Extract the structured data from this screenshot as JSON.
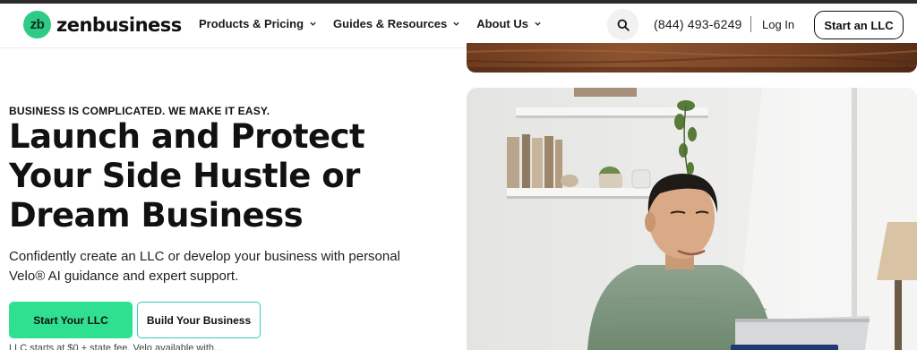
{
  "brand": {
    "logo_mark": "zb",
    "logo_text": "zenbusiness",
    "accent_color": "#2fe090",
    "outline_accent_color": "#2fcfb9"
  },
  "nav": {
    "items": [
      {
        "label": "Products & Pricing",
        "icon": "chevron-down-icon"
      },
      {
        "label": "Guides & Resources",
        "icon": "chevron-down-icon"
      },
      {
        "label": "About Us",
        "icon": "chevron-down-icon"
      }
    ]
  },
  "header_actions": {
    "search_icon": "search-icon",
    "phone": "(844) 493-6249",
    "separator": "|",
    "login_label": "Log In",
    "cta_label": "Start an LLC"
  },
  "hero": {
    "eyebrow": "BUSINESS IS COMPLICATED. WE MAKE IT EASY.",
    "headline_line1": "Launch and Protect",
    "headline_line2": "Your Side Hustle or",
    "headline_line3": "Dream Business",
    "subtext_line1": "Confidently create an LLC or develop your business with personal",
    "subtext_line2": "Velo® AI guidance and expert support.",
    "primary_cta": "Start Your LLC",
    "secondary_cta": "Build Your Business",
    "footnote": "LLC starts at $0 + state fee. Velo available with..."
  }
}
